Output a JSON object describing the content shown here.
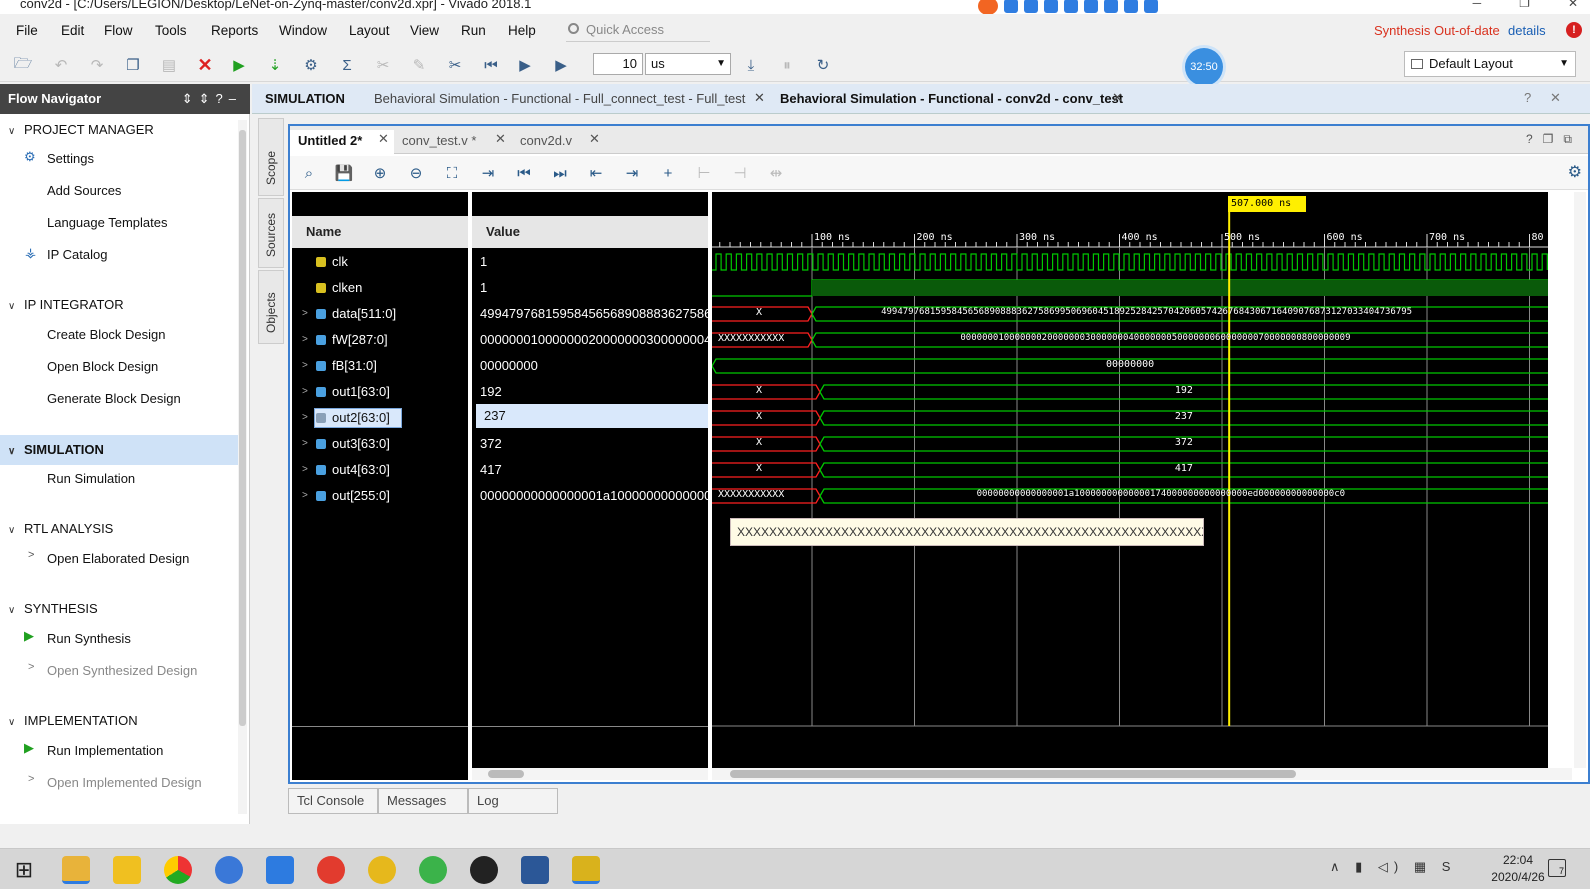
{
  "window": {
    "title": "conv2d - [C:/Users/LEGION/Desktop/LeNet-on-Zynq-master/conv2d.xpr] - Vivado 2018.1"
  },
  "menu": [
    "File",
    "Edit",
    "Flow",
    "Tools",
    "Reports",
    "Window",
    "Layout",
    "View",
    "Run",
    "Help"
  ],
  "quick_access": {
    "placeholder": "Quick Access"
  },
  "status": {
    "synthesis": "Synthesis Out-of-date",
    "details": "details",
    "error_badge": "!"
  },
  "toolbar": {
    "run_time": "10",
    "time_unit": "us",
    "clock_badge": "32:50",
    "layout": "Default Layout"
  },
  "navigator": {
    "title": "Flow Navigator",
    "sections": [
      {
        "label": "PROJECT MANAGER",
        "items": [
          "Settings",
          "Add Sources",
          "Language Templates",
          "IP Catalog"
        ]
      },
      {
        "label": "IP INTEGRATOR",
        "items": [
          "Create Block Design",
          "Open Block Design",
          "Generate Block Design"
        ]
      },
      {
        "label": "SIMULATION",
        "items": [
          "Run Simulation"
        ]
      },
      {
        "label": "RTL ANALYSIS",
        "items": [
          "Open Elaborated Design"
        ]
      },
      {
        "label": "SYNTHESIS",
        "items": [
          "Run Synthesis",
          "Open Synthesized Design"
        ]
      },
      {
        "label": "IMPLEMENTATION",
        "items": [
          "Run Implementation",
          "Open Implemented Design"
        ]
      }
    ]
  },
  "sim_tabs": {
    "label": "SIMULATION",
    "tabs": [
      "Behavioral Simulation - Functional - Full_connect_test - Full_test",
      "Behavioral Simulation - Functional - conv2d - conv_test"
    ]
  },
  "side_tabs": [
    "Scope",
    "Sources",
    "Objects"
  ],
  "wave_tabs": [
    "Untitled 2*",
    "conv_test.v *",
    "conv2d.v"
  ],
  "columns": {
    "name": "Name",
    "value": "Value"
  },
  "signals": [
    {
      "name": "clk",
      "value": "1",
      "wave": "1"
    },
    {
      "name": "clken",
      "value": "1",
      "wave": ""
    },
    {
      "name": "data[511:0]",
      "value": "4994797681595845656890888362758699",
      "wave": "49947976815958456568908883627586995069604518925284257042060574267684306716409076873127033404736795",
      "pre": "X"
    },
    {
      "name": "fW[287:0]",
      "value": "0000000100000002000000030000000400000005",
      "wave": "000000010000000200000003000000040000000500000006000000070000000800000009",
      "pre": "XXXXXXXXXXX"
    },
    {
      "name": "fB[31:0]",
      "value": "00000000",
      "wave": "00000000"
    },
    {
      "name": "out1[63:0]",
      "value": "192",
      "wave": "192",
      "pre": "X"
    },
    {
      "name": "out2[63:0]",
      "value": "237",
      "wave": "237",
      "pre": "X"
    },
    {
      "name": "out3[63:0]",
      "value": "372",
      "wave": "372",
      "pre": "X"
    },
    {
      "name": "out4[63:0]",
      "value": "417",
      "wave": "417",
      "pre": "X"
    },
    {
      "name": "out[255:0]",
      "value": "00000000000000001a10000000000000174000",
      "wave": "00000000000000001a10000000000000174000000000000000ed00000000000000c0",
      "pre": "XXXXXXXXXXX"
    }
  ],
  "waveform": {
    "cursor_label": "507.000 ns",
    "time_ticks": [
      "100 ns",
      "200 ns",
      "300 ns",
      "400 ns",
      "500 ns",
      "600 ns",
      "700 ns",
      "80"
    ],
    "tooltip": "XXXXXXXXXXXXXXXXXXXXXXXXXXXXXXXXXXXXXXXXXXXXXXXXXXXXXXXXXXXXXXXXXXXXXXX"
  },
  "bottom_tabs": [
    "Tcl Console",
    "Messages",
    "Log"
  ],
  "taskbar": {
    "time": "22:04",
    "date": "2020/4/26",
    "notifications": "7"
  },
  "colors": {
    "accent": "#3c7fd0",
    "wave_green": "#00c800",
    "wave_red": "#ff2020",
    "cursor": "#ffef00"
  }
}
